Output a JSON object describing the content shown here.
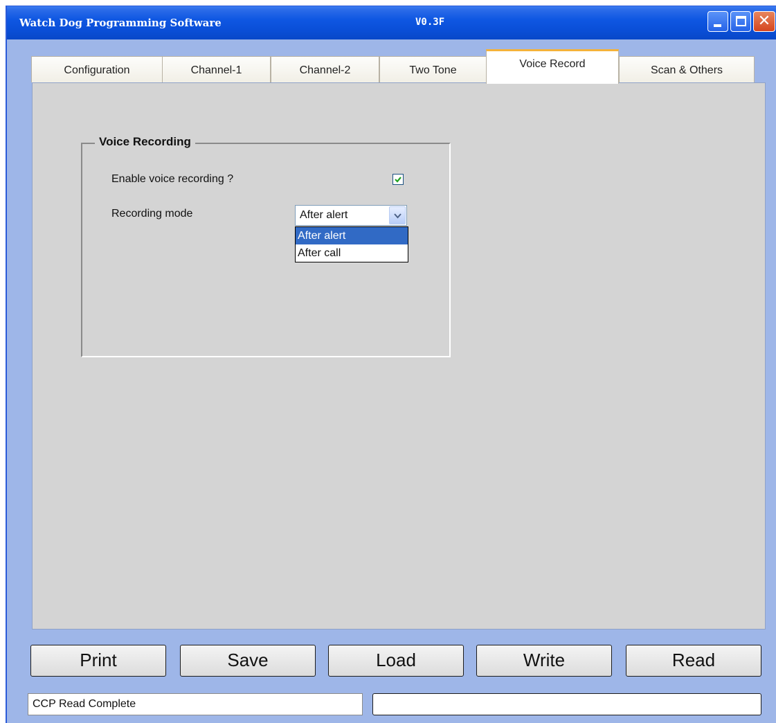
{
  "window": {
    "title": "Watch Dog Programming Software",
    "version": "V0.3F"
  },
  "tabs": [
    {
      "label": "Configuration"
    },
    {
      "label": "Channel-1"
    },
    {
      "label": "Channel-2"
    },
    {
      "label": "Two Tone"
    },
    {
      "label": "Voice Record",
      "active": true
    },
    {
      "label": "Scan & Others"
    }
  ],
  "voice_recording": {
    "group_title": "Voice Recording",
    "enable_label": "Enable voice recording ?",
    "enable_checked": true,
    "mode_label": "Recording mode",
    "mode_value": "After alert",
    "mode_options": [
      "After alert",
      "After call"
    ],
    "mode_highlighted": "After alert"
  },
  "buttons": {
    "print": "Print",
    "save": "Save",
    "load": "Load",
    "write": "Write",
    "read": "Read"
  },
  "status": {
    "left": "CCP Read Complete",
    "right": ""
  },
  "colors": {
    "titlebar": "#0a4fd8",
    "frame": "#9eb6e8",
    "panel": "#d4d4d4",
    "active_tab_accent": "#f4b23a",
    "selection": "#316ac5"
  },
  "icons": [
    "minimize-icon",
    "maximize-icon",
    "close-icon",
    "checkmark-icon",
    "chevron-down-icon"
  ]
}
